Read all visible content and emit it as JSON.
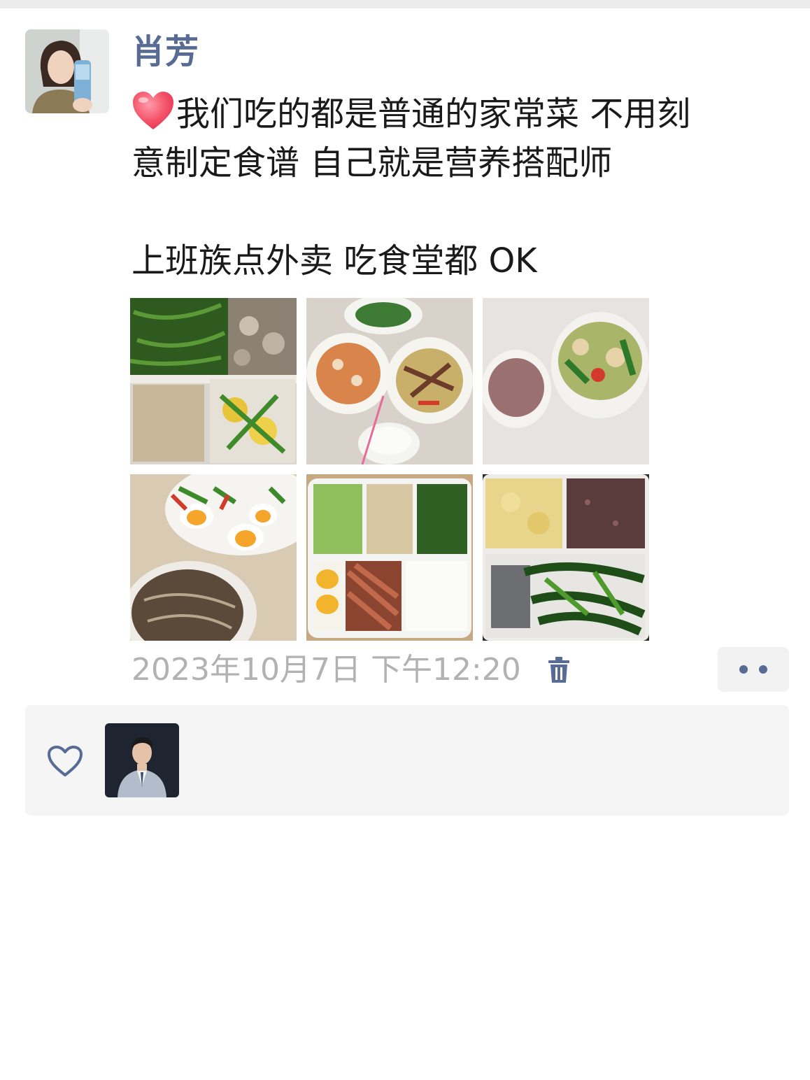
{
  "post": {
    "author": "肖芳",
    "text_lines": [
      "我们吃的都是普通的家常菜 不用刻",
      "意制定食谱 自己就是营养搭配师",
      "",
      "上班族点外卖 吃食堂都 OK"
    ],
    "leading_emoji": "heart-emoji",
    "timestamp": "2023年10月7日 下午12:20",
    "photos": [
      {
        "name": "photo-greens-mushrooms-eggs"
      },
      {
        "name": "photo-tofu-bamboo-dishes"
      },
      {
        "name": "photo-rice-vegetable-bowls"
      },
      {
        "name": "photo-eggs-salad-noodles"
      },
      {
        "name": "photo-bento-bacon-rice"
      },
      {
        "name": "photo-eggs-grains-greens"
      }
    ]
  },
  "actions": {
    "delete_icon": "trash-icon",
    "more_icon": "more-dots-icon"
  },
  "likes": {
    "icon": "heart-outline-icon",
    "liker_count": 1
  },
  "colors": {
    "name_blue": "#576b95",
    "timestamp_gray": "#b2b2b2",
    "panel_bg": "#f5f5f5"
  }
}
